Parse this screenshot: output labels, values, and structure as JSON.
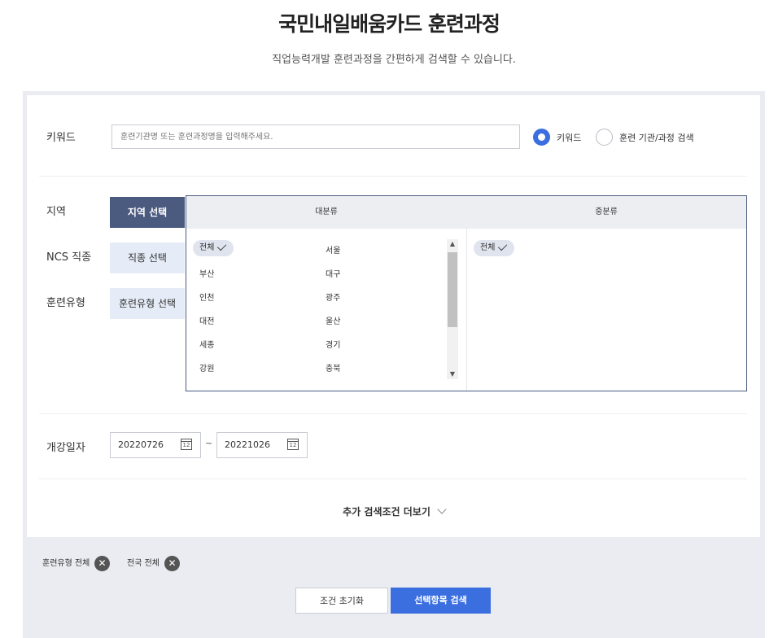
{
  "header": {
    "title": "국민내일배움카드 훈련과정",
    "subtitle": "직업능력개발 훈련과정을 간편하게 검색할 수 있습니다."
  },
  "keyword": {
    "label": "키워드",
    "placeholder": "훈련기관명 또는 훈련과정명을 입력해주세요.",
    "radio_options": [
      {
        "label": "키워드",
        "selected": true
      },
      {
        "label": "훈련 기관/과정 검색",
        "selected": false
      }
    ]
  },
  "filters": {
    "region": {
      "label": "지역",
      "button": "지역 선택"
    },
    "ncs": {
      "label": "NCS 직종",
      "button": "직종 선택"
    },
    "training_type": {
      "label": "훈련유형",
      "button": "훈련유형 선택"
    }
  },
  "dropdown": {
    "col1_title": "대분류",
    "col2_title": "중분류",
    "major_items": [
      "전체",
      "서울",
      "부산",
      "대구",
      "인천",
      "광주",
      "대전",
      "울산",
      "세종",
      "경기",
      "강원",
      "충북"
    ],
    "sub_items": [
      "전체"
    ]
  },
  "dates": {
    "label": "개강일자",
    "start": "20220726",
    "end": "20221026",
    "separator": "~",
    "calendar_icon_text": "12"
  },
  "more_label": "추가 검색조건 더보기",
  "selected_tags": [
    "훈련유형 전체",
    "전국 전체"
  ],
  "tag_remove_symbol": "✕",
  "buttons": {
    "reset": "조건 초기화",
    "search": "선택항목 검색"
  },
  "colors": {
    "accent": "#3b6fe0",
    "nav_active": "#4b5a7f",
    "panel_bg": "#ebecf1"
  }
}
